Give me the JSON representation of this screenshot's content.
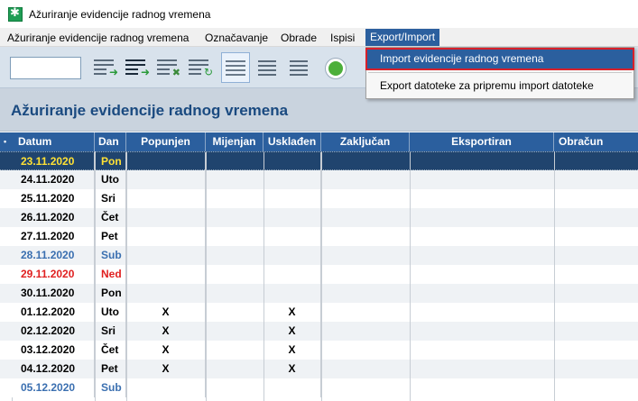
{
  "window": {
    "title": "Ažuriranje evidencije radnog vremena"
  },
  "menu": [
    {
      "label": "Ažuriranje evidencije radnog vremena"
    },
    {
      "label": "Označavanje"
    },
    {
      "label": "Obrade"
    },
    {
      "label": "Ispisi"
    },
    {
      "label": "Export/Import",
      "active": true
    }
  ],
  "dropdown": {
    "items": [
      {
        "label": "Import evidencije radnog vremena",
        "highlighted": true
      },
      {
        "label": "Export datoteke za pripremu import datoteke"
      }
    ]
  },
  "toolbar": {
    "search_value": "",
    "icons": [
      "list-add-icon",
      "list-move-icon",
      "list-delete-icon",
      "list-refresh-icon",
      "list-view-icon",
      "list-compact-icon",
      "list-plain-icon",
      "status-circle-icon"
    ]
  },
  "section": {
    "title": "Ažuriranje evidencije radnog vremena"
  },
  "table": {
    "indicator": "•",
    "columns": [
      "Datum",
      "Dan",
      "Popunjen",
      "Mijenjan",
      "Usklađen",
      "Zaključan",
      "Eksportiran",
      "Obračun"
    ],
    "rows": [
      {
        "date": "23.11.2020",
        "day": "Pon",
        "popunjen": "",
        "uskladen": "",
        "style": "selected"
      },
      {
        "date": "24.11.2020",
        "day": "Uto",
        "popunjen": "",
        "uskladen": "",
        "style": "normal"
      },
      {
        "date": "25.11.2020",
        "day": "Sri",
        "popunjen": "",
        "uskladen": "",
        "style": "normal"
      },
      {
        "date": "26.11.2020",
        "day": "Čet",
        "popunjen": "",
        "uskladen": "",
        "style": "normal"
      },
      {
        "date": "27.11.2020",
        "day": "Pet",
        "popunjen": "",
        "uskladen": "",
        "style": "normal"
      },
      {
        "date": "28.11.2020",
        "day": "Sub",
        "popunjen": "",
        "uskladen": "",
        "style": "saturday"
      },
      {
        "date": "29.11.2020",
        "day": "Ned",
        "popunjen": "",
        "uskladen": "",
        "style": "sunday"
      },
      {
        "date": "30.11.2020",
        "day": "Pon",
        "popunjen": "",
        "uskladen": "",
        "style": "normal"
      },
      {
        "date": "01.12.2020",
        "day": "Uto",
        "popunjen": "X",
        "uskladen": "X",
        "style": "normal"
      },
      {
        "date": "02.12.2020",
        "day": "Sri",
        "popunjen": "X",
        "uskladen": "X",
        "style": "normal"
      },
      {
        "date": "03.12.2020",
        "day": "Čet",
        "popunjen": "X",
        "uskladen": "X",
        "style": "normal"
      },
      {
        "date": "04.12.2020",
        "day": "Pet",
        "popunjen": "X",
        "uskladen": "X",
        "style": "normal"
      },
      {
        "date": "05.12.2020",
        "day": "Sub",
        "popunjen": "",
        "uskladen": "",
        "style": "saturday"
      }
    ]
  },
  "colors": {
    "accent": "#2b5f9e",
    "selected_row_bg": "#20446e",
    "selected_row_text": "#ffe135",
    "saturday_text": "#3a6fb0",
    "sunday_text": "#e02020",
    "highlight_outline": "#d8202a"
  }
}
